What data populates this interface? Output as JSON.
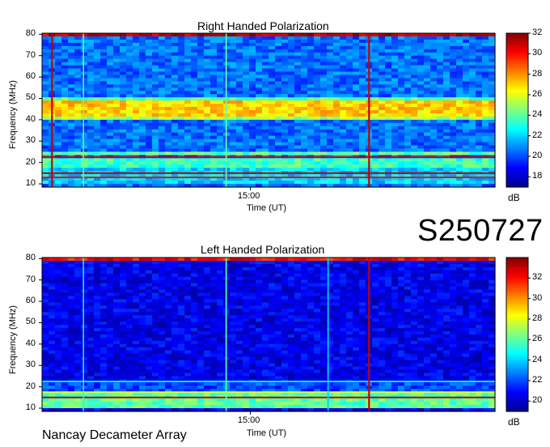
{
  "code": "S250727",
  "footer": "Nancay Decameter Array",
  "colormap": [
    "#00008f",
    "#0000ff",
    "#0080ff",
    "#00ffff",
    "#80ff80",
    "#ffff00",
    "#ff8000",
    "#ff0000",
    "#800000"
  ],
  "chart_data": [
    {
      "type": "heatmap",
      "title": "Right Handed Polarization",
      "xlabel": "Time (UT)",
      "ylabel": "Frequency (MHz)",
      "x_ticks": [
        "15:00"
      ],
      "y_ticks": [
        10,
        20,
        30,
        40,
        50,
        60,
        70,
        80
      ],
      "ylim": [
        8.5,
        80.5
      ],
      "colorbar": {
        "label": "dB",
        "ticks": [
          18,
          20,
          22,
          24,
          26,
          28,
          30,
          32
        ],
        "range": [
          17,
          32
        ]
      },
      "base_level": 20.5,
      "bands": [
        {
          "f0": 42,
          "f1": 49,
          "db": 27
        },
        {
          "f0": 40.5,
          "f1": 42,
          "db": 25
        },
        {
          "f0": 49,
          "f1": 50.5,
          "db": 24
        },
        {
          "f0": 17,
          "f1": 22,
          "db": 23.5
        },
        {
          "f0": 23,
          "f1": 25,
          "db": 24
        },
        {
          "f0": 10,
          "f1": 17,
          "db": 22
        },
        {
          "f0": 78.5,
          "f1": 80,
          "db": 31
        },
        {
          "f0": 73,
          "f1": 73.6,
          "db": 25
        }
      ],
      "lines": [
        {
          "f": 22.5,
          "db": 31
        },
        {
          "f": 15,
          "db": 31
        },
        {
          "f": 13,
          "db": 30
        }
      ],
      "bursts": [
        {
          "t": 0.02,
          "db": 31,
          "w": 0.004
        },
        {
          "t": 0.72,
          "db": 31,
          "w": 0.004
        },
        {
          "t": 0.09,
          "db": 24,
          "w": 0.002
        },
        {
          "t": 0.405,
          "db": 24,
          "w": 0.003
        }
      ]
    },
    {
      "type": "heatmap",
      "title": "Left Handed Polarization",
      "xlabel": "Time (UT)",
      "ylabel": "Frequency (MHz)",
      "x_ticks": [
        "15:00"
      ],
      "y_ticks": [
        10,
        20,
        30,
        40,
        50,
        60,
        70,
        80
      ],
      "ylim": [
        8.5,
        80.5
      ],
      "colorbar": {
        "label": "dB",
        "ticks": [
          20,
          22,
          24,
          26,
          28,
          30,
          32
        ],
        "range": [
          19,
          34
        ]
      },
      "base_level": 20.5,
      "bands": [
        {
          "f0": 10,
          "f1": 17,
          "db": 26
        },
        {
          "f0": 17,
          "f1": 22,
          "db": 22
        },
        {
          "f0": 78.5,
          "f1": 80,
          "db": 32
        },
        {
          "f0": 73,
          "f1": 73.6,
          "db": 25
        },
        {
          "f0": 35,
          "f1": 36,
          "db": 23.5
        }
      ],
      "lines": [
        {
          "f": 15,
          "db": 33
        },
        {
          "f": 17.5,
          "db": 28
        },
        {
          "f": 22.5,
          "db": 24.5
        }
      ],
      "bursts": [
        {
          "t": 0.72,
          "db": 33,
          "w": 0.004
        },
        {
          "t": 0.09,
          "db": 25,
          "w": 0.002
        },
        {
          "t": 0.405,
          "db": 26,
          "w": 0.003
        },
        {
          "t": 0.63,
          "db": 24,
          "w": 0.003
        }
      ]
    }
  ]
}
